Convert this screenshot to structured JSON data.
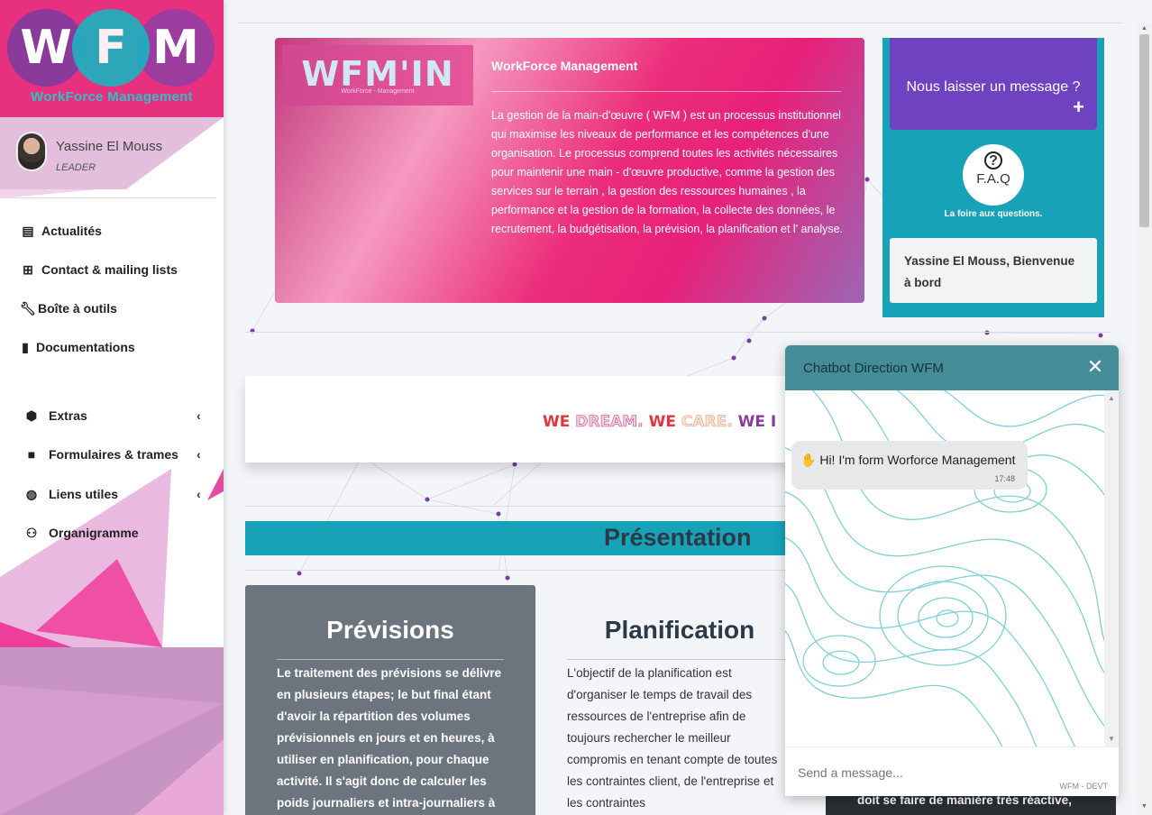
{
  "brand": {
    "letters": [
      "W",
      "F",
      "M"
    ],
    "subtitle": "WorkForce Management"
  },
  "user": {
    "name": "Yassine El Mouss",
    "role": "LEADER"
  },
  "nav": {
    "items": [
      {
        "label": "Actualités",
        "icon": "newspaper-icon"
      },
      {
        "label": "Contact & mailing lists",
        "icon": "table-icon"
      },
      {
        "label": "Boîte à outils",
        "icon": "wrench-icon"
      },
      {
        "label": "Documentations",
        "icon": "book-icon"
      },
      {
        "label": "Extras",
        "icon": "cubes-icon"
      },
      {
        "label": "Formulaires & trames",
        "icon": "folder-icon"
      },
      {
        "label": "Liens utiles",
        "icon": "globe-icon"
      },
      {
        "label": "Organigramme",
        "icon": "users-icon"
      }
    ]
  },
  "hero": {
    "logo_main": "WFM'IN",
    "logo_sub": "WorkForce - Management",
    "title": "WorkForce Management",
    "text": "La gestion de la main-d'œuvre ( WFM ) est un processus institutionnel qui maximise les niveaux de performance et les compétences d'une organisation. Le processus comprend toutes les activités nécessaires pour maintenir une main - d'œuvre productive, comme la gestion des services sur le terrain , la gestion des ressources humaines , la performance et la gestion de la formation, la collecte des données, le recrutement, la budgétisation, la prévision, la planification et l' analyse."
  },
  "side_panel": {
    "message_label": "Nous laisser un message ?",
    "plus": "+",
    "faq_icon": "?",
    "faq_label": "F.A.Q",
    "faq_sub": "La foire aux questions.",
    "welcome": "Yassine El Mouss, Bienvenue à bord"
  },
  "banner": {
    "parts": [
      "WE ",
      "DREAM. ",
      "WE ",
      "CARE. ",
      "WE ",
      "I"
    ]
  },
  "presentation": {
    "title": "Présentation"
  },
  "cards": {
    "previsions": {
      "title": "Prévisions",
      "text": "Le traitement des prévisions se délivre en plusieurs étapes; le but final étant d'avoir la répartition des volumes prévisionnels en jours et en heures, à utiliser en planification, pour chaque activité. Il s'agit donc de calculer les poids journaliers et intra-journaliers à"
    },
    "planification": {
      "title": "Planification",
      "text": "L'objectif de la planification est d'organiser le temps de travail des ressources de l'entreprise afin de toujours rechercher le meilleur compromis en tenant compte de toutes les contraintes client, de l'entreprise et les contraintes"
    },
    "dark_snippet": "doit se faire de manière très réactive,"
  },
  "chat": {
    "title": "Chatbot Direction WFM",
    "close": "✕",
    "message": "Hi! I'm form Worforce Management",
    "message_icon": "✋",
    "time": "17:48",
    "input_placeholder": "Send a message...",
    "footer": "WFM - DEVT"
  },
  "colors": {
    "brand_pink": "#e8317e",
    "teal": "#17a2b8",
    "purple": "#6f42c1",
    "chat_header": "#448c97",
    "gray_card": "#6c757d"
  }
}
